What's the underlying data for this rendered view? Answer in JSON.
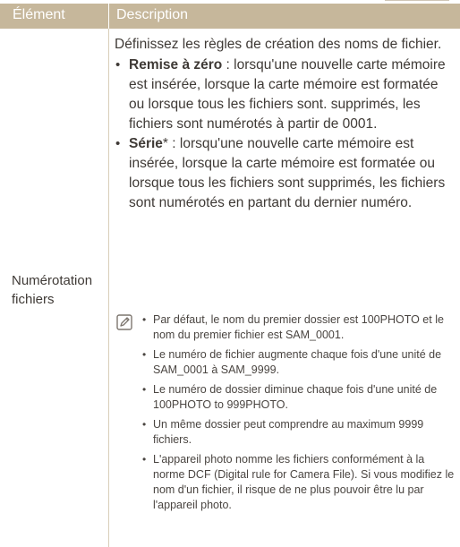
{
  "table": {
    "header": {
      "element": "Élément",
      "description": "Description"
    },
    "row": {
      "element_label": "Numérotation fichiers",
      "intro": "Définissez les règles de création des noms de fichier.",
      "options": [
        {
          "term": "Remise à zéro",
          "asterisk": "",
          "text": " : lorsqu'une nouvelle carte mémoire est insérée, lorsque la carte mémoire est formatée ou lorsque tous les fichiers sont. supprimés, les fichiers sont numérotés à partir de 0001."
        },
        {
          "term": "Série",
          "asterisk": "*",
          "text": " : lorsqu'une nouvelle carte mémoire est insérée, lorsque la carte mémoire est formatée ou lorsque tous les fichiers sont supprimés, les fichiers sont numérotés en partant du dernier numéro."
        }
      ],
      "notes": [
        "Par défaut, le nom du premier dossier est 100PHOTO et le nom du premier fichier est SAM_0001.",
        "Le numéro de fichier augmente chaque fois d'une unité de SAM_0001 à SAM_9999.",
        "Le numéro de dossier diminue chaque fois d'une unité de 100PHOTO to 999PHOTO.",
        "Un même dossier peut comprendre au maximum 9999 fichiers.",
        "L'appareil photo nomme les fichiers conformément à la norme DCF (Digital rule for Camera File). Si vous modifiez le nom d'un fichier, il risque de ne plus pouvoir être lu par l'appareil photo."
      ],
      "note_icon": "note-pencil-icon"
    }
  }
}
